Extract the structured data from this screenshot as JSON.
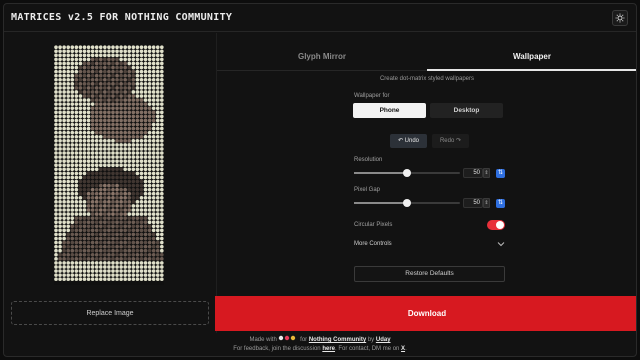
{
  "app": {
    "title": "MATRICES v2.5 FOR NOTHING COMMUNITY",
    "theme_icon": "sun-icon"
  },
  "left": {
    "replace_label": "Replace Image",
    "preview_icon": "dot-matrix-preview"
  },
  "tabs": [
    {
      "label": "Glyph Mirror",
      "active": false
    },
    {
      "label": "Wallpaper",
      "active": true
    }
  ],
  "wallpaper": {
    "subtitle": "Create dot-matrix styled wallpapers",
    "wallpaper_for_label": "Wallpaper for",
    "device_options": [
      {
        "label": "Phone",
        "active": true
      },
      {
        "label": "Desktop",
        "active": false
      }
    ],
    "undo_label": "Undo",
    "redo_label": "Redo",
    "resolution": {
      "label": "Resolution",
      "value": "50",
      "level": 0.5
    },
    "pixel_gap": {
      "label": "Pixel Gap",
      "value": "50",
      "level": 0.5
    },
    "circular_pixels": {
      "label": "Circular Pixels",
      "enabled": true
    },
    "more_controls_label": "More Controls",
    "restore_label": "Restore Defaults",
    "download_label": "Download"
  },
  "footer": {
    "line1_prefix": "Made with",
    "line1_for": "for",
    "community": "Nothing Community",
    "by": "by",
    "author": "Uday",
    "line2_prefix": "For feedback, join the discussion",
    "here": "here",
    "line2_mid": ". For contact, DM me on",
    "x": "X",
    "line2_end": "."
  },
  "colors": {
    "accent_red": "#d71920",
    "toggle_red": "#e8303a",
    "lock_blue": "#2f6fe0"
  }
}
